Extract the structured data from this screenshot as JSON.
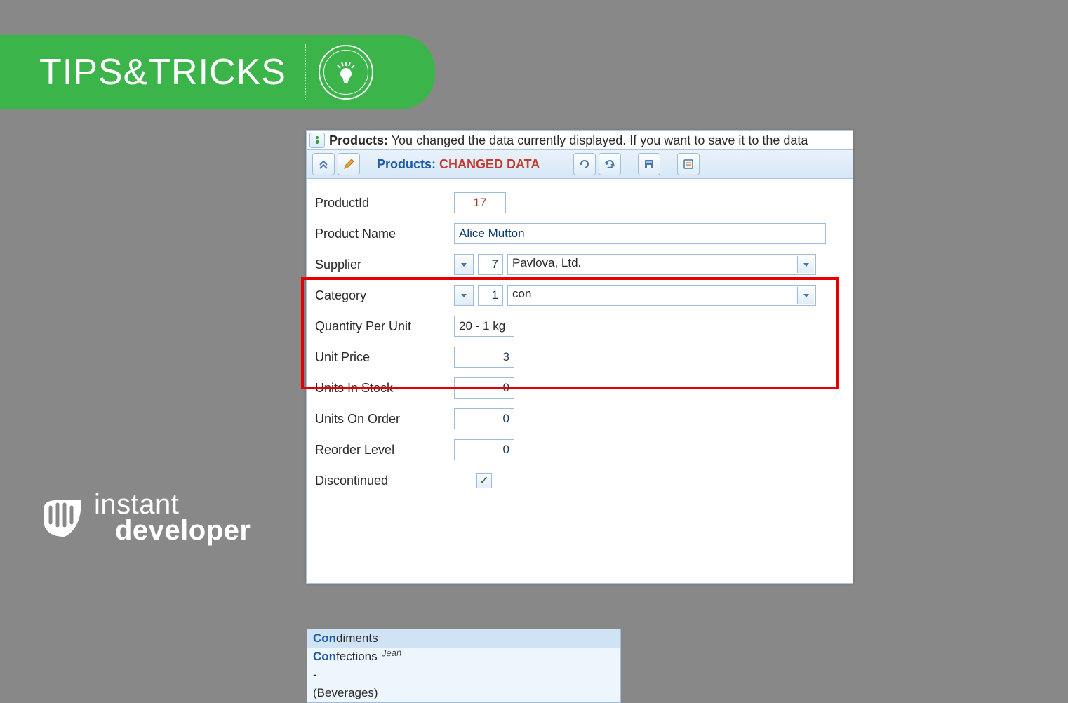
{
  "banner": {
    "title_a": "TIPS",
    "title_amp": "&",
    "title_b": "TRICKS"
  },
  "brand": {
    "line1": "instant",
    "line2": "developer"
  },
  "header": {
    "prefix": "Products:",
    "message": " You changed the data currently displayed. If you want to save it to the data"
  },
  "toolbar": {
    "title_a": "Products: ",
    "title_b": "CHANGED DATA"
  },
  "form": {
    "labels": {
      "productId": "ProductId",
      "productName": "Product Name",
      "supplier": "Supplier",
      "category": "Category",
      "qtyPerUnit": "Quantity Per Unit",
      "unitPrice": "Unit Price",
      "unitsInStock": "Units In Stock",
      "unitsOnOrder": "Units On Order",
      "reorderLevel": "Reorder Level",
      "discontinued": "Discontinued"
    },
    "values": {
      "productId": "17",
      "productName": "Alice Mutton",
      "supplierId": "7",
      "supplierName": "Pavlova, Ltd.",
      "categoryId": "1",
      "categorySearch": "con",
      "qtyPerUnit": "20 - 1 kg",
      "unitPrice": "3",
      "unitsInStock": "0",
      "unitsOnOrder": "0",
      "reorderLevel": "0",
      "discontinuedChecked": "✓"
    },
    "dropdown": {
      "hlPrefix": "Con",
      "items": [
        {
          "rest": "diments"
        },
        {
          "rest": "fections"
        }
      ],
      "blank": "-",
      "current": "(Beverages)",
      "annotation": "Jean"
    }
  }
}
